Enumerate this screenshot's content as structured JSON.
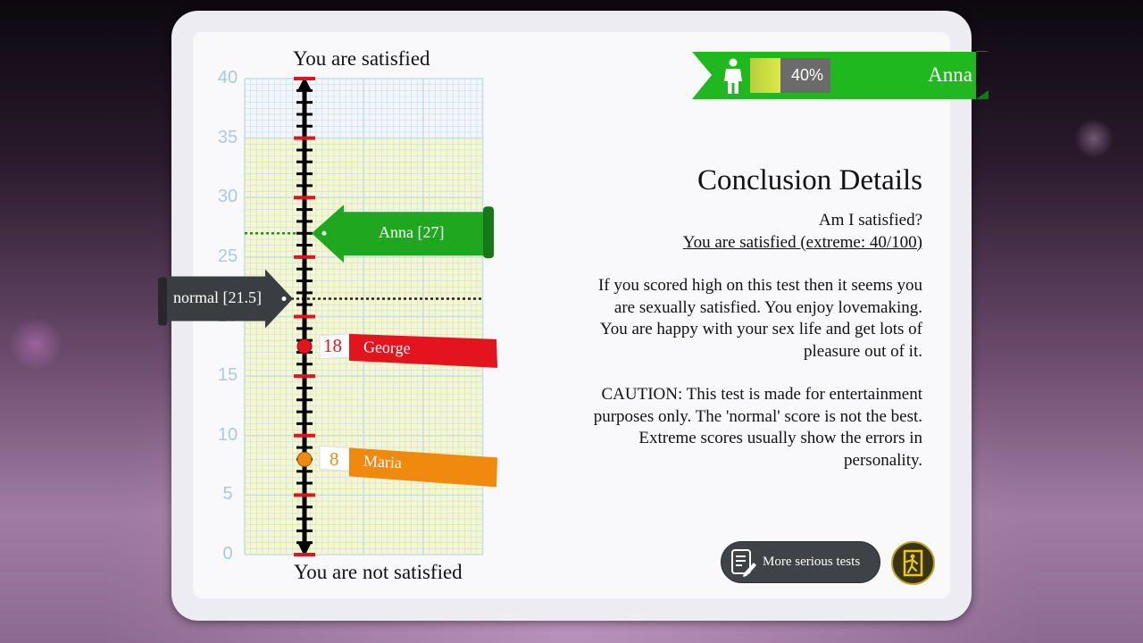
{
  "scale": {
    "top_label": "You are satisfied",
    "bottom_label": "You are not satisfied",
    "ticks": [
      "40",
      "35",
      "30",
      "25",
      "20",
      "15",
      "10",
      "5",
      "0"
    ],
    "range": [
      0,
      40
    ],
    "highlight_max": 35
  },
  "markers": {
    "anna": {
      "label": "Anna [27]",
      "value": 27,
      "color": "#1fa81f"
    },
    "normal": {
      "label": "normal [21.5]",
      "value": 21.5,
      "color": "#3a3d42"
    },
    "george": {
      "score": "18",
      "name": "George",
      "value": 17.5,
      "color": "#e4141e"
    },
    "maria": {
      "score": "8",
      "name": "Maria",
      "value": 8,
      "color": "#f08a0f"
    }
  },
  "person": {
    "name": "Anna",
    "percent": "40%",
    "percent_value": 40,
    "color": "#1fb81f"
  },
  "conclusion": {
    "title": "Conclusion Details",
    "question": "Am I satisfied?",
    "answer": "You are satisfied (extreme: 40/100)",
    "description_lines": [
      "If you scored high on this test then it seems you",
      "are sexually satisfied. You enjoy lovemaking.",
      "You are happy with your sex life and get lots of",
      "pleasure out of it."
    ],
    "caution_lines": [
      "CAUTION: This test is made for entertainment",
      "purposes only. The 'normal' score is not the best.",
      "Extreme scores usually show the errors in",
      "personality."
    ]
  },
  "buttons": {
    "more_tests": "More serious tests"
  },
  "icons": {
    "person": "person-icon",
    "tests": "document-pencil-icon",
    "exit": "exit-door-icon"
  }
}
